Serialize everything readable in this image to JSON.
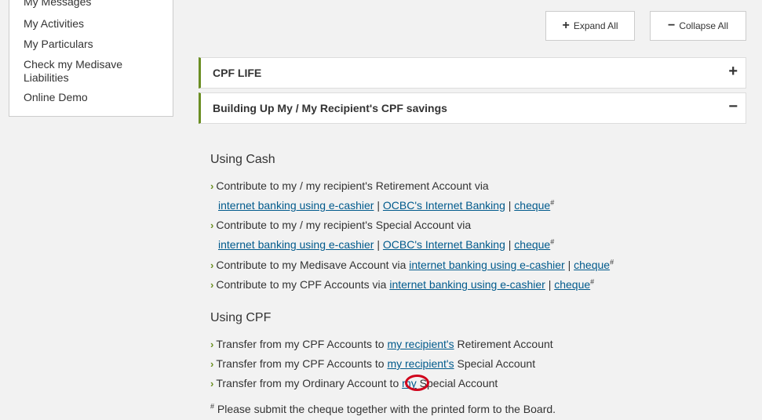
{
  "sidebar": {
    "items": [
      {
        "label": "My Messages"
      },
      {
        "label": "My Activities"
      },
      {
        "label": "My Particulars"
      },
      {
        "label": "Check my Medisave Liabilities"
      },
      {
        "label": "Online Demo"
      }
    ]
  },
  "toolbar": {
    "expand_label": "Expand All",
    "collapse_label": "Collapse All"
  },
  "accordions": [
    {
      "title": "CPF LIFE",
      "state": "+"
    },
    {
      "title": "Building Up My / My Recipient's CPF savings",
      "state": "−"
    }
  ],
  "using_cash": {
    "title": "Using Cash",
    "items": [
      {
        "text": "Contribute to my / my recipient's Retirement Account via"
      },
      {
        "text": "Contribute to my / my recipient's Special Account via"
      },
      {
        "text": "Contribute to my Medisave Account via"
      },
      {
        "text": "Contribute to my CPF Accounts via"
      }
    ],
    "links": {
      "ecashier": "internet banking using e-cashier",
      "ocbc": "OCBC's Internet Banking",
      "cheque": "cheque",
      "hash": "#",
      "sep": "|"
    }
  },
  "using_cpf": {
    "title": "Using CPF",
    "items": [
      {
        "prefix": "Transfer from my CPF Accounts to ",
        "link": "my recipient's",
        "suffix": " Retirement Account"
      },
      {
        "prefix": "Transfer from my CPF Accounts to ",
        "link": "my recipient's",
        "suffix": " Special Account"
      },
      {
        "prefix": "Transfer from my Ordinary Account to ",
        "link": "my",
        "suffix": " Special Account"
      }
    ]
  },
  "footnote": {
    "mark": "#",
    "text": " Please submit the cheque together with the printed form to the Board."
  }
}
